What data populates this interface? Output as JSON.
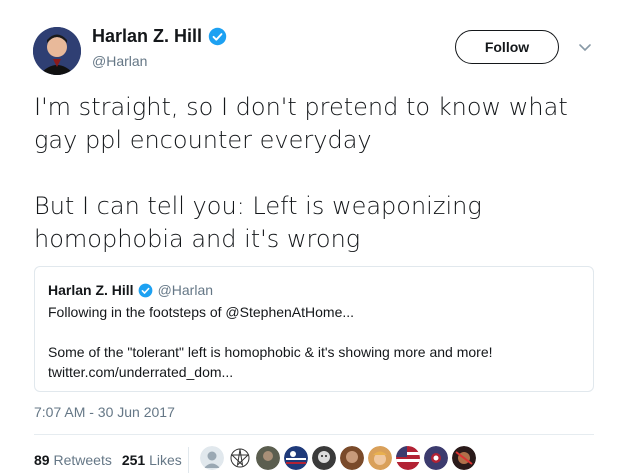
{
  "author": {
    "name": "Harlan Z. Hill",
    "handle": "@Harlan",
    "verified": true
  },
  "follow_button": {
    "label": "Follow"
  },
  "tweet": {
    "paragraphs": [
      {
        "line1": "I'm straight, so I don't pretend to know what",
        "line2": "gay ppl encounter everyday"
      },
      {
        "line1": "But I can tell you: Left is weaponizing",
        "line2": "homophobia and it's wrong"
      }
    ]
  },
  "quoted_tweet": {
    "name": "Harlan Z. Hill",
    "handle": "@Harlan",
    "line1": "Following in the footsteps of @StephenAtHome...",
    "line2": "Some of the \"tolerant\" left is homophobic & it's showing more and more!",
    "line3": "twitter.com/underrated_dom..."
  },
  "timestamp": "7:07 AM - 30 Jun 2017",
  "stats": {
    "retweets_count": "89",
    "retweets_label": "Retweets",
    "likes_count": "251",
    "likes_label": "Likes"
  },
  "likers": [
    {
      "icon": "default-avatar-icon",
      "color": "#e1e8ed"
    },
    {
      "icon": "pentagram-icon",
      "color": "#ffffff"
    },
    {
      "icon": "avatar-photo-icon",
      "color": "#5b5e4f"
    },
    {
      "icon": "flag-avatar-icon",
      "color": "#1f3a7a"
    },
    {
      "icon": "avatar-photo-icon",
      "color": "#3a3a3a"
    },
    {
      "icon": "avatar-photo-icon",
      "color": "#7a4a2a"
    },
    {
      "icon": "avatar-photo-icon",
      "color": "#d9a05a"
    },
    {
      "icon": "flag-avatar-icon",
      "color": "#b22234"
    },
    {
      "icon": "flag-avatar-icon",
      "color": "#3c3b6e"
    },
    {
      "icon": "avatar-photo-icon",
      "color": "#2a1a1a"
    }
  ],
  "colors": {
    "verified_blue": "#1da1f2",
    "secondary_text": "#657786"
  }
}
